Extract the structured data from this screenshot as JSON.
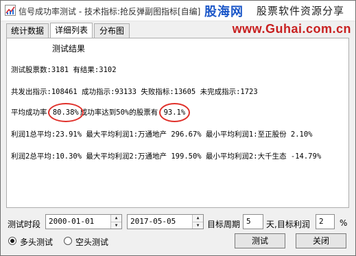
{
  "window": {
    "title": "信号成功率测试 - 技术指标:抢反弹副图指标[自编]指"
  },
  "watermark": {
    "brand": "股海网",
    "slogan": "股票软件资源分享",
    "url": "www.Guhai.com.cn"
  },
  "tabs": [
    {
      "label": "统计数据",
      "active": false
    },
    {
      "label": "详细列表",
      "active": true
    },
    {
      "label": "分布图",
      "active": false
    }
  ],
  "results": {
    "title": "测试结果",
    "stocks_line": "测试股票数:3181 有结果:3102",
    "signals_line": "共发出指示:108461 成功指示:93133 失败指标:13605 未完成指示:1723",
    "success_label": "平均成功率:",
    "success_value": "80.38%",
    "success_mid": "成功率达到50%的股票有:",
    "success_stock_value": "93.1%",
    "profit1_line": "利润1总平均:23.91% 最大平均利润1:万通地产 296.67% 最小平均利润1:至正股份 2.10%",
    "profit2_line": "利润2总平均:10.30% 最大平均利润2:万通地产 199.50% 最小平均利润2:大千生态 -14.79%"
  },
  "controls": {
    "period_label": "测试时段",
    "start_date": "2000-01-01",
    "end_date": "2017-05-05",
    "target_period_label": "目标周期",
    "target_period_value": "5",
    "target_profit_label": "天,目标利润",
    "target_profit_value": "2",
    "percent_unit": "%",
    "mode_long_label": "多头测试",
    "mode_short_label": "空头测试",
    "selected_mode": "多头测试",
    "test_button": "测试",
    "close_button": "关闭"
  }
}
